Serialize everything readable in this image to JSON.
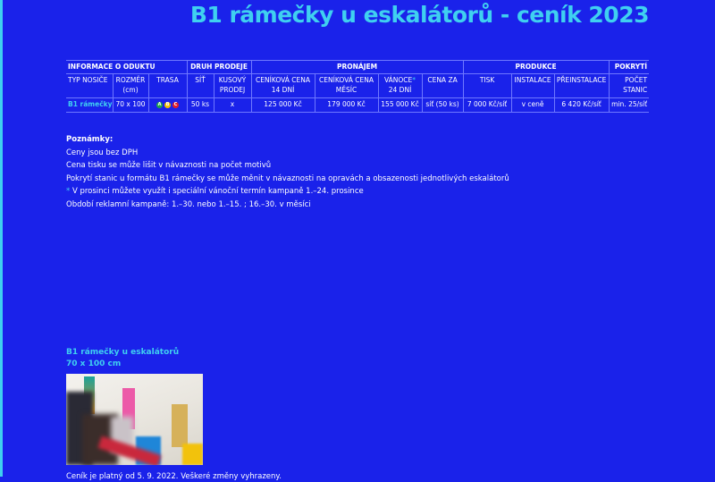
{
  "title": "B1 rámečky u eskalátorů - ceník 2023",
  "table": {
    "groups": [
      "INFORMACE O ODUKTU",
      "DRUH PRODEJE",
      "PRONÁJEM",
      "PRODUKCE",
      "POKRYTÍ"
    ],
    "headers": [
      "TYP NOSIČE",
      "ROZMĚR (cm)",
      "TRASA",
      "SÍŤ",
      "KUSOVÝ PRODEJ",
      "CENÍKOVÁ CENA 14 DNÍ",
      "CENÍKOVÁ CENA MĚSÍC",
      "VÁNOCE",
      "24 DNÍ",
      "CENA ZA",
      "TISK",
      "INSTALACE",
      "PŘEINSTALACE",
      "POČET STANIC"
    ],
    "row": {
      "type": "B1 rámečky",
      "size": "70 x 100",
      "lines": [
        {
          "label": "A",
          "color": "#1fa34a"
        },
        {
          "label": "B",
          "color": "#f5c400"
        },
        {
          "label": "C",
          "color": "#e3202a"
        }
      ],
      "net": "50 ks",
      "single": "x",
      "price14": "125 000 Kč",
      "priceMonth": "179 000 Kč",
      "xmas": "155 000 Kč",
      "priceFor": "síť (50 ks)",
      "print": "7 000 Kč/síť",
      "install": "v ceně",
      "reinstall": "6 420 Kč/síť",
      "stations": "min. 25/síť"
    }
  },
  "notes": {
    "heading": "Poznámky:",
    "lines": [
      "Ceny jsou bez DPH",
      "Cena tisku se může lišit v návaznosti na počet motivů",
      "Pokrytí stanic u formátu B1 rámečky se může měnit v návaznosti na opravách a obsazenosti jednotlivých eskalátorů",
      "V prosinci můžete využít i speciální vánoční termín kampaně 1.–24. prosince",
      "Období reklamní kampaně: 1.–30. nebo 1.–15. ; 16.–30. v měsíci"
    ],
    "star": "*"
  },
  "caption": {
    "line1": "B1 rámečky u eskalátorů",
    "line2": "70 x 100 cm"
  },
  "footer": "Ceník je platný od 5. 9. 2022. Veškeré změny vyhrazeny.",
  "colors": {
    "background": "#1a22ea",
    "accent": "#3fd0f0"
  }
}
